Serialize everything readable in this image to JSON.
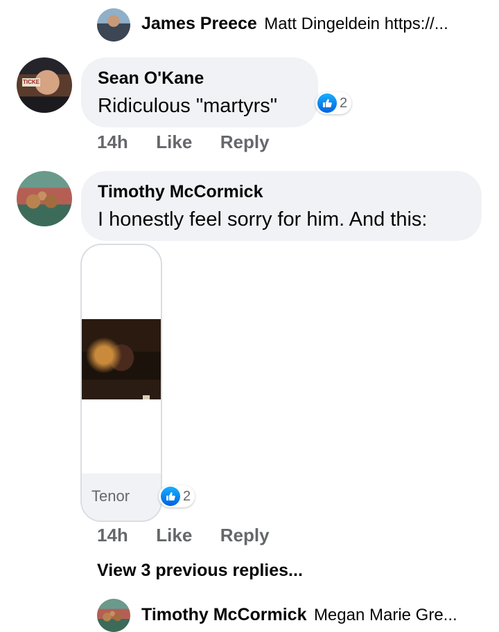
{
  "thread": {
    "top_reply": {
      "author": "James Preece",
      "preview": "Matt Dingeldein  https://..."
    },
    "comments": [
      {
        "author": "Sean O'Kane",
        "text": "Ridiculous \"martyrs\"",
        "reaction_count": "2",
        "time": "14h",
        "like_label": "Like",
        "reply_label": "Reply"
      },
      {
        "author": "Timothy McCormick",
        "text": "I honestly feel sorry for him. And this:",
        "gif_source": "Tenor",
        "reaction_count": "2",
        "time": "14h",
        "like_label": "Like",
        "reply_label": "Reply"
      }
    ],
    "view_previous": "View 3 previous replies...",
    "bottom_reply": {
      "author": "Timothy McCormick",
      "preview": "Megan Marie Gre..."
    }
  },
  "colors": {
    "bubble_bg": "#f0f2f5",
    "meta_text": "#65676b",
    "like_blue": "#1877f2"
  },
  "icons": [
    "thumbs-up-icon"
  ]
}
